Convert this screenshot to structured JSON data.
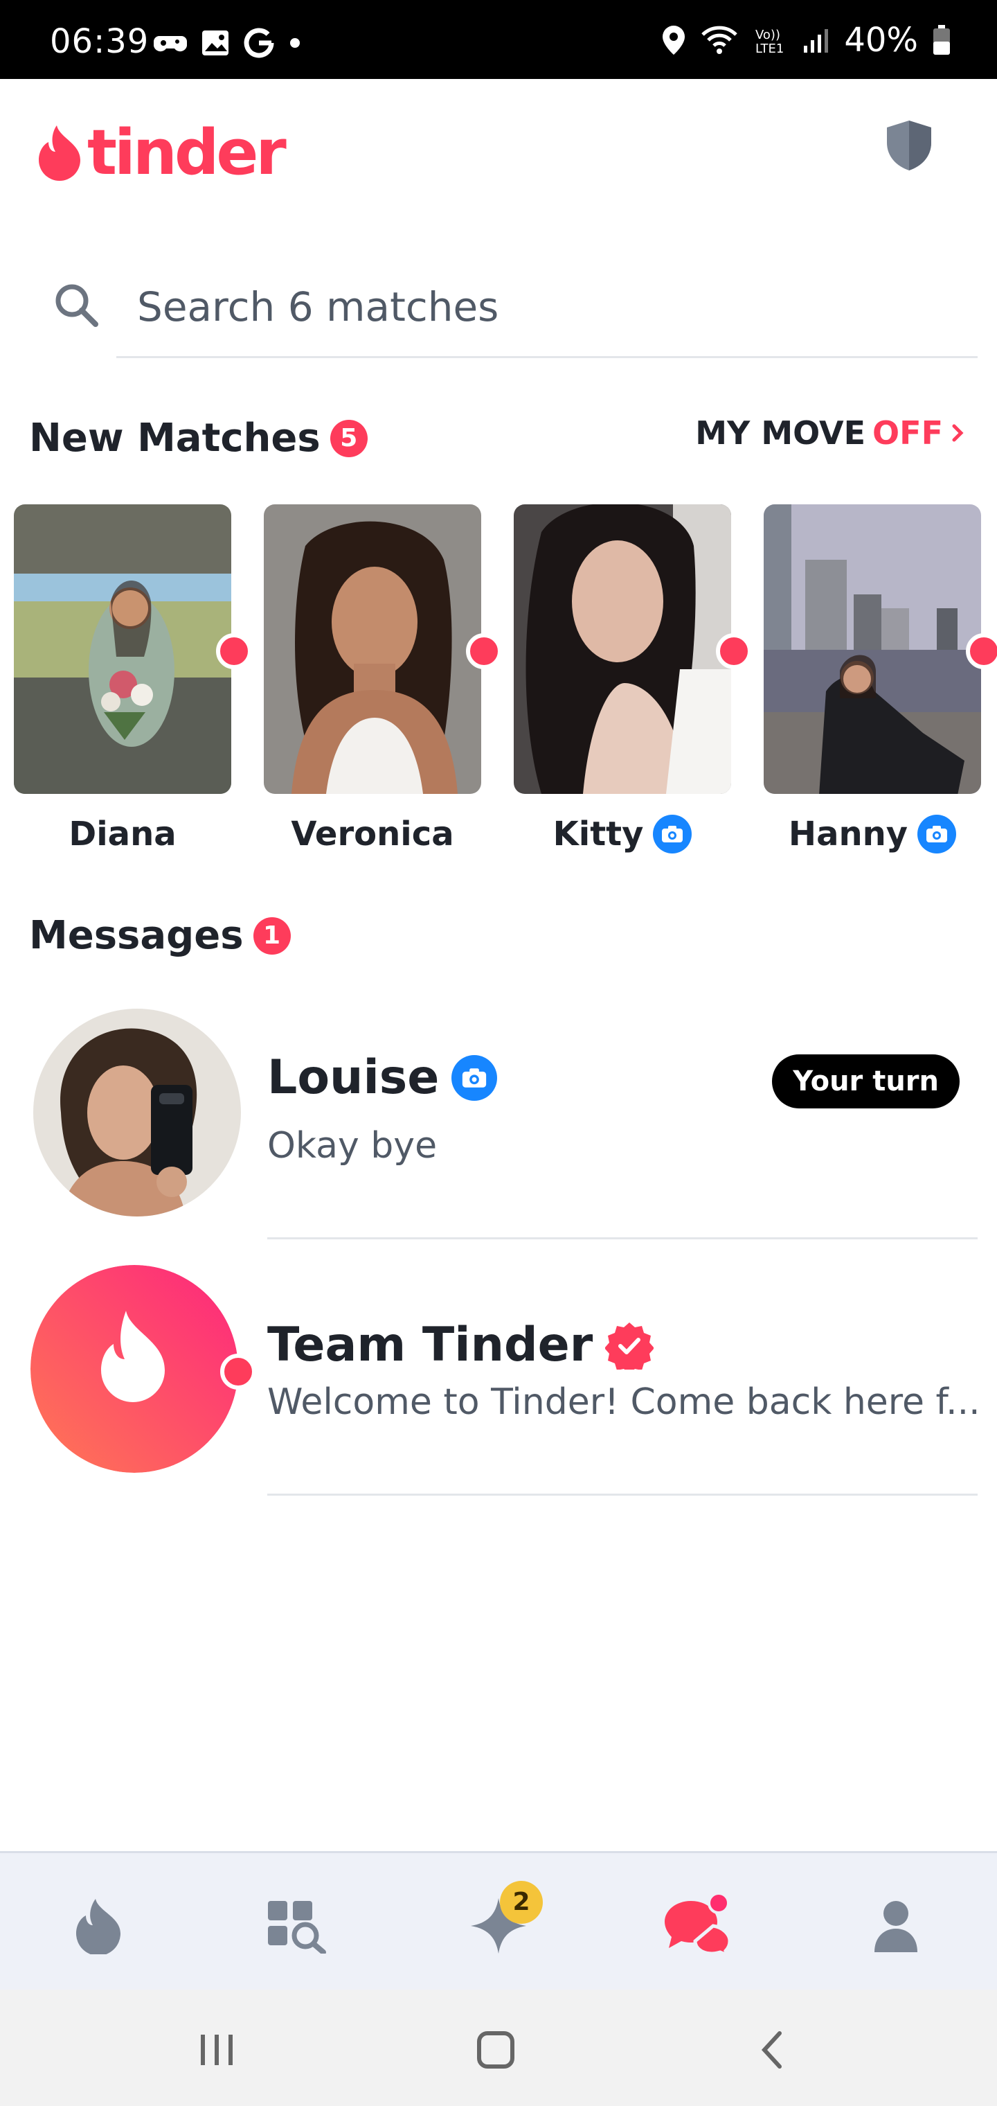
{
  "status_bar": {
    "time": "06:39",
    "battery": "40%",
    "icons": [
      "game-controller-icon",
      "gallery-icon",
      "google-icon",
      "dot-icon",
      "location-icon",
      "wifi-icon",
      "volte-icon",
      "signal-icon",
      "battery-icon"
    ]
  },
  "header": {
    "logo_text": "tinder",
    "safety_icon": "shield-icon"
  },
  "search": {
    "placeholder": "Search 6 matches"
  },
  "new_matches": {
    "title": "New Matches",
    "count": "5",
    "my_move_label": "MY MOVE",
    "my_move_state": "OFF",
    "items": [
      {
        "name": "Diana",
        "verified": false
      },
      {
        "name": "Veronica",
        "verified": false
      },
      {
        "name": "Kitty",
        "verified": true
      },
      {
        "name": "Hanny",
        "verified": true
      }
    ]
  },
  "messages": {
    "title": "Messages",
    "count": "1",
    "items": [
      {
        "name": "Louise",
        "preview": "Okay bye",
        "tag": "Your turn",
        "photo_verified": true
      },
      {
        "name": "Team Tinder",
        "preview": "Welcome to Tinder! Come back here f...",
        "official_verified": true
      }
    ]
  },
  "bottom_nav": {
    "items": [
      "flame-icon",
      "explore-icon",
      "sparkle-icon",
      "chat-icon",
      "profile-icon"
    ],
    "sparkle_badge": "2",
    "active": "chat-icon"
  },
  "colors": {
    "brand": "#fe3c5b",
    "verified_blue": "#1786ff",
    "nav_bg": "#eef1f8"
  }
}
